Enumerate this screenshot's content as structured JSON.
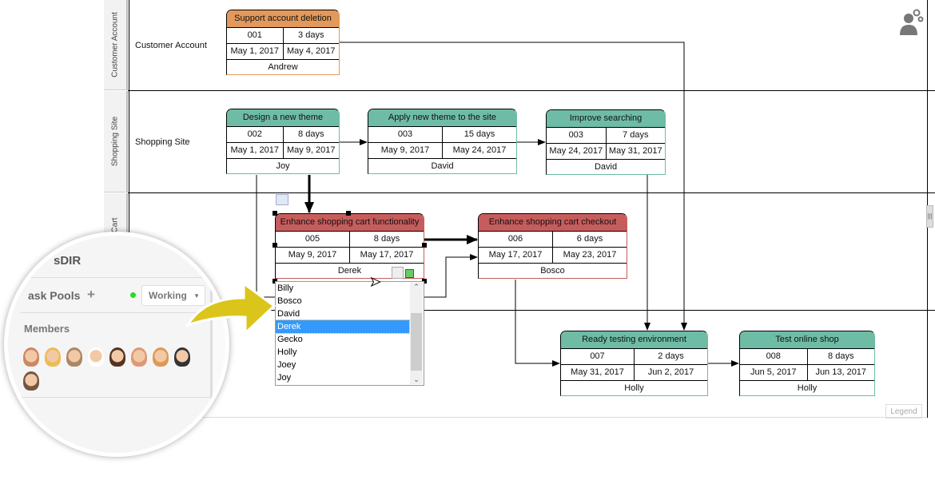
{
  "lanes": [
    {
      "label": "Customer Account",
      "header": "Customer Account"
    },
    {
      "label": "Shopping Site",
      "header": "Shopping Site"
    },
    {
      "label": "",
      "header": "Cart"
    },
    {
      "label": "",
      "header": ""
    }
  ],
  "tasks": [
    {
      "title": "Support account deletion",
      "id": "001",
      "duration": "3 days",
      "start": "May 1, 2017",
      "end": "May 4, 2017",
      "owner": "Andrew",
      "color": "#e3995c"
    },
    {
      "title": "Design a new theme",
      "id": "002",
      "duration": "8 days",
      "start": "May 1, 2017",
      "end": "May 9, 2017",
      "owner": "Joy",
      "color": "#6fbca6"
    },
    {
      "title": "Apply new theme to the site",
      "id": "003",
      "duration": "15 days",
      "start": "May 9, 2017",
      "end": "May 24, 2017",
      "owner": "David",
      "color": "#6fbca6"
    },
    {
      "title": "Improve searching",
      "id": "003",
      "duration": "7 days",
      "start": "May 24, 2017",
      "end": "May 31, 2017",
      "owner": "David",
      "color": "#6fbca6"
    },
    {
      "title": "Enhance shopping cart functionality",
      "id": "005",
      "duration": "8 days",
      "start": "May 9, 2017",
      "end": "May 17, 2017",
      "owner": "Derek",
      "color": "#c75c5c"
    },
    {
      "title": "Enhance shopping cart checkout",
      "id": "006",
      "duration": "6 days",
      "start": "May 17, 2017",
      "end": "May 23, 2017",
      "owner": "Bosco",
      "color": "#c75c5c"
    },
    {
      "title": "Ready testing environment",
      "id": "007",
      "duration": "2 days",
      "start": "May 31, 2017",
      "end": "Jun 2, 2017",
      "owner": "Holly",
      "color": "#6fbca6"
    },
    {
      "title": "Test online shop",
      "id": "008",
      "duration": "8 days",
      "start": "Jun 5, 2017",
      "end": "Jun 13, 2017",
      "owner": "Holly",
      "color": "#6fbca6"
    }
  ],
  "owner_dropdown": {
    "options": [
      "Billy",
      "Bosco",
      "David",
      "Derek",
      "Gecko",
      "Holly",
      "Joey",
      "Joy"
    ],
    "selected": "Derek"
  },
  "legend": "Legend",
  "magnifier": {
    "project": "sDIR",
    "task_pools": "ask Pools",
    "add": "+",
    "status": "Working",
    "status_color": "#22dd22",
    "members": "Members",
    "member_count": 9
  },
  "icons": [
    "user-settings-icon",
    "resize-handle-icon",
    "scroll-grip-icon"
  ]
}
